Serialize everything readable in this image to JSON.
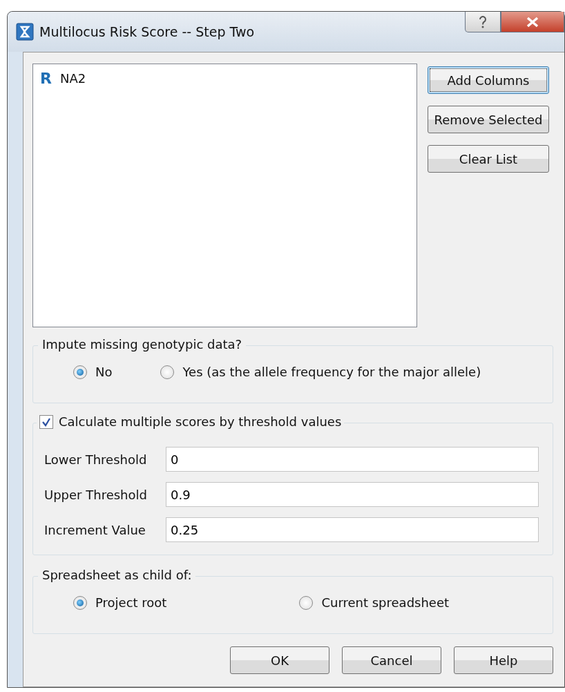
{
  "window": {
    "title": "Multilocus Risk Score -- Step Two"
  },
  "list": {
    "items": [
      {
        "type_letter": "R",
        "label": "NA2"
      }
    ]
  },
  "side_buttons": [
    {
      "label": "Add Columns",
      "focused": true
    },
    {
      "label": "Remove Selected",
      "focused": false
    },
    {
      "label": "Clear List",
      "focused": false
    }
  ],
  "impute": {
    "legend": "Impute missing genotypic data?",
    "options": [
      {
        "label": "No",
        "selected": true
      },
      {
        "label": "Yes (as the allele frequency for the major allele)",
        "selected": false
      }
    ]
  },
  "thresholds": {
    "checkbox": {
      "label": "Calculate multiple scores by threshold values",
      "checked": true
    },
    "fields": [
      {
        "label": "Lower Threshold",
        "value": "0"
      },
      {
        "label": "Upper Threshold",
        "value": "0.9"
      },
      {
        "label": "Increment Value",
        "value": "0.25"
      }
    ]
  },
  "parent": {
    "legend": "Spreadsheet as child of:",
    "options": [
      {
        "label": "Project root",
        "selected": true
      },
      {
        "label": "Current spreadsheet",
        "selected": false
      }
    ]
  },
  "footer_buttons": [
    "OK",
    "Cancel",
    "Help"
  ]
}
